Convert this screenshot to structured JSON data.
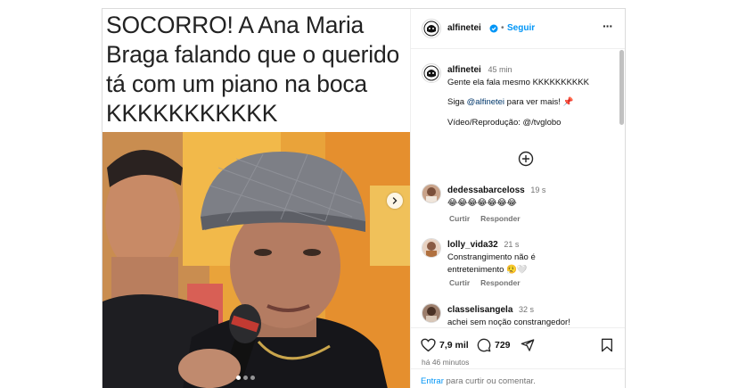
{
  "post": {
    "caption_overlay": "SOCORRO! A Ana Maria Braga falando que o querido tá com um piano na boca KKKKKKKKKKK"
  },
  "header": {
    "username": "alfinetei",
    "verified_dot": "•",
    "follow_label": "Seguir",
    "more_label": "···"
  },
  "caption": {
    "username": "alfinetei",
    "time": "45 min",
    "line1": "Gente ela fala mesmo KKKKKKKKKK",
    "line2_prefix": "Siga ",
    "line2_mention": "@alfinetei",
    "line2_suffix": " para ver mais! 📌",
    "line3": "Vídeo/Reprodução: @/tvglobo"
  },
  "comments": [
    {
      "username": "dedessabarceloss",
      "time": "19 s",
      "text": "😂😂😂😂😂😂😂",
      "reply_label": "Curtir",
      "answer_label": "Responder"
    },
    {
      "username": "lolly_vida32",
      "time": "21 s",
      "text": "Constrangimento não é entretenimento 😮‍💨🤍",
      "reply_label": "Curtir",
      "answer_label": "Responder"
    },
    {
      "username": "classelisangela",
      "time": "32 s",
      "text": "achei sem noção constrangedor!"
    }
  ],
  "actions": {
    "likes": "7,9 mil",
    "comments": "729",
    "time_ago": "há 46 minutos"
  },
  "footer": {
    "enter": "Entrar",
    "rest": " para curtir ou comentar."
  },
  "colors": {
    "accent": "#0095f6",
    "muted": "#737373",
    "border": "#dbdbdb"
  },
  "icons": [
    "chevron-right-icon",
    "verified-badge-icon",
    "more-icon",
    "add-circle-icon",
    "heart-icon",
    "comment-icon",
    "share-icon",
    "bookmark-icon"
  ]
}
